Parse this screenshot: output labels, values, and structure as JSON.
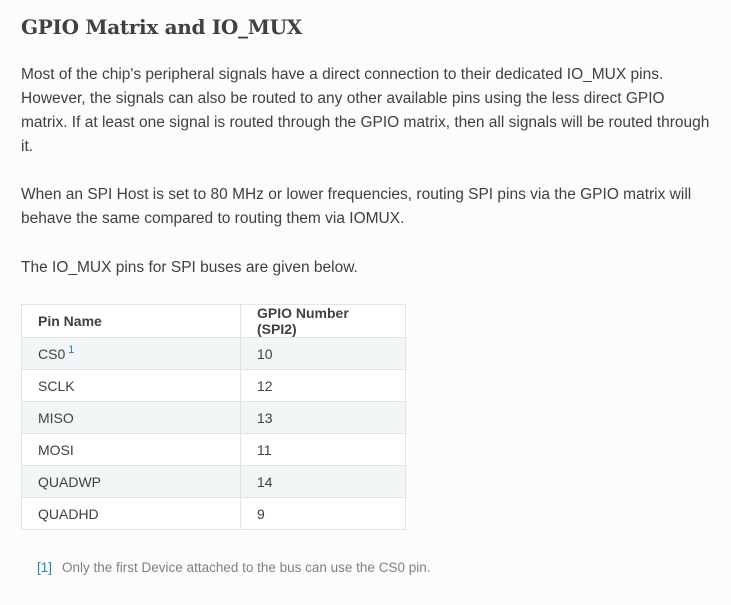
{
  "heading": "GPIO Matrix and IO_MUX",
  "paragraphs": [
    "Most of the chip's peripheral signals have a direct connection to their dedicated IO_MUX pins. However, the signals can also be routed to any other available pins using the less direct GPIO matrix. If at least one signal is routed through the GPIO matrix, then all signals will be routed through it.",
    "When an SPI Host is set to 80 MHz or lower frequencies, routing SPI pins via the GPIO matrix will behave the same compared to routing them via IOMUX.",
    "The IO_MUX pins for SPI buses are given below."
  ],
  "table": {
    "headers": [
      "Pin Name",
      "GPIO Number (SPI2)"
    ],
    "rows": [
      {
        "pin": "CS0",
        "footnote_ref": "1",
        "gpio": "10"
      },
      {
        "pin": "SCLK",
        "gpio": "12"
      },
      {
        "pin": "MISO",
        "gpio": "13"
      },
      {
        "pin": "MOSI",
        "gpio": "11"
      },
      {
        "pin": "QUADWP",
        "gpio": "14"
      },
      {
        "pin": "QUADHD",
        "gpio": "9"
      }
    ]
  },
  "footnote": {
    "label": "[1]",
    "text": "Only the first Device attached to the bus can use the CS0 pin."
  },
  "colors": {
    "text": "#404040",
    "link": "#2980b9",
    "table_border": "#e1e4e5",
    "row_stripe": "#f3f6f6"
  }
}
